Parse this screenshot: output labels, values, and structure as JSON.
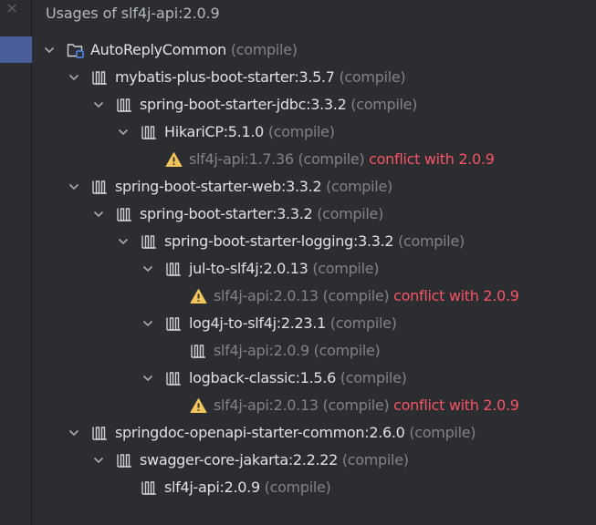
{
  "panel": {
    "title": "Usages of slf4j-api:2.0.9"
  },
  "colors": {
    "background": "#2b2d30",
    "text": "#dfe1e5",
    "muted": "#808389",
    "conflict": "#f75464",
    "warning": "#f2c55c",
    "selection": "#4a5f9a"
  },
  "tree": {
    "rows": [
      {
        "name": "AutoReplyCommon",
        "scope": "(compile)",
        "conflict": "",
        "icon": "module-icon",
        "expanded": true,
        "dim": false
      },
      {
        "name": "mybatis-plus-boot-starter:3.5.7",
        "scope": "(compile)",
        "conflict": "",
        "icon": "library-icon",
        "expanded": true,
        "dim": false
      },
      {
        "name": "spring-boot-starter-jdbc:3.3.2",
        "scope": "(compile)",
        "conflict": "",
        "icon": "library-icon",
        "expanded": true,
        "dim": false
      },
      {
        "name": "HikariCP:5.1.0",
        "scope": "(compile)",
        "conflict": "",
        "icon": "library-icon",
        "expanded": true,
        "dim": false
      },
      {
        "name": "slf4j-api:1.7.36",
        "scope": "(compile)",
        "conflict": "conflict with 2.0.9",
        "icon": "warning-icon",
        "expanded": false,
        "dim": true
      },
      {
        "name": "spring-boot-starter-web:3.3.2",
        "scope": "(compile)",
        "conflict": "",
        "icon": "library-icon",
        "expanded": true,
        "dim": false
      },
      {
        "name": "spring-boot-starter:3.3.2",
        "scope": "(compile)",
        "conflict": "",
        "icon": "library-icon",
        "expanded": true,
        "dim": false
      },
      {
        "name": "spring-boot-starter-logging:3.3.2",
        "scope": "(compile)",
        "conflict": "",
        "icon": "library-icon",
        "expanded": true,
        "dim": false
      },
      {
        "name": "jul-to-slf4j:2.0.13",
        "scope": "(compile)",
        "conflict": "",
        "icon": "library-icon",
        "expanded": true,
        "dim": false
      },
      {
        "name": "slf4j-api:2.0.13",
        "scope": "(compile)",
        "conflict": "conflict with 2.0.9",
        "icon": "warning-icon",
        "expanded": false,
        "dim": true
      },
      {
        "name": "log4j-to-slf4j:2.23.1",
        "scope": "(compile)",
        "conflict": "",
        "icon": "library-icon",
        "expanded": true,
        "dim": false
      },
      {
        "name": "slf4j-api:2.0.9",
        "scope": "(compile)",
        "conflict": "",
        "icon": "library-icon",
        "expanded": false,
        "dim": true
      },
      {
        "name": "logback-classic:1.5.6",
        "scope": "(compile)",
        "conflict": "",
        "icon": "library-icon",
        "expanded": true,
        "dim": false
      },
      {
        "name": "slf4j-api:2.0.13",
        "scope": "(compile)",
        "conflict": "conflict with 2.0.9",
        "icon": "warning-icon",
        "expanded": false,
        "dim": true
      },
      {
        "name": "springdoc-openapi-starter-common:2.6.0",
        "scope": "(compile)",
        "conflict": "",
        "icon": "library-icon",
        "expanded": true,
        "dim": false
      },
      {
        "name": "swagger-core-jakarta:2.2.22",
        "scope": "(compile)",
        "conflict": "",
        "icon": "library-icon",
        "expanded": true,
        "dim": false
      },
      {
        "name": "slf4j-api:2.0.9",
        "scope": "(compile)",
        "conflict": "",
        "icon": "library-icon",
        "expanded": false,
        "dim": false
      }
    ]
  }
}
